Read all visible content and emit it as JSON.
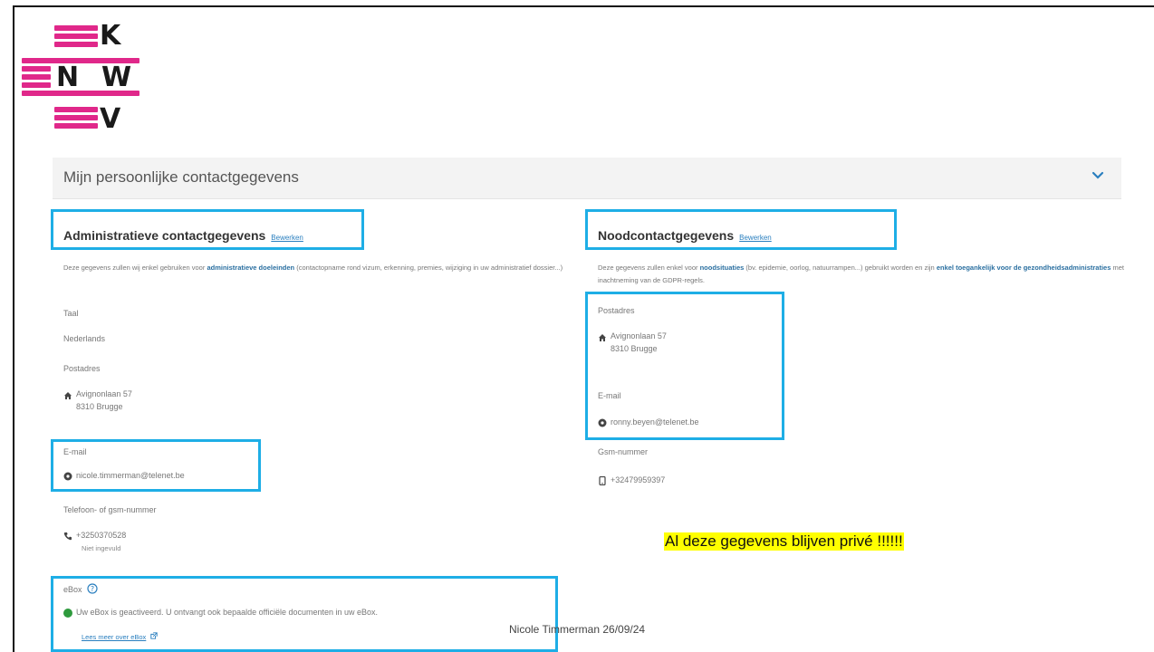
{
  "logo": {
    "letters": [
      "K",
      "N",
      "W",
      "V"
    ],
    "color": "#e0288a",
    "alt": "KNWV"
  },
  "section": {
    "title": "Mijn persoonlijke contactgegevens",
    "chevron_icon": "chevron-down-icon"
  },
  "admin": {
    "title": "Administratieve contactgegevens",
    "edit_label": "Bewerken",
    "desc_before": "Deze gegevens zullen wij enkel gebruiken voor ",
    "desc_bold": "administratieve doeleinden",
    "desc_after": " (contactopname rond vizum, erkenning, premies, wijziging in uw administratief dossier...)",
    "taal_label": "Taal",
    "taal_value": "Nederlands",
    "postadres_label": "Postadres",
    "address_line1": "Avignonlaan 57",
    "address_line2": "8310 Brugge",
    "email_label": "E-mail",
    "email_value": "nicole.timmerman@telenet.be",
    "phone_label": "Telefoon- of gsm-nummer",
    "phone_value": "+3250370528",
    "phone_note": "Niet ingevuld",
    "ebox_label": "eBox",
    "ebox_status": "Uw eBox is geactiveerd. U ontvangt ook bepaalde officiële documenten in uw eBox.",
    "ebox_link": "Lees meer over eBox"
  },
  "emergency": {
    "title": "Noodcontactgegevens",
    "edit_label": "Bewerken",
    "desc_before": "Deze gegevens zullen enkel voor ",
    "desc_bold1": "noodsituaties",
    "desc_mid": " (bv. epidemie, oorlog, natuurrampen...) gebruikt worden en zijn ",
    "desc_bold2": "enkel toegankelijk voor de gezondheidsadministraties",
    "desc_after": " met inachtneming van de GDPR-regels.",
    "postadres_label": "Postadres",
    "address_line1": "Avignonlaan 57",
    "address_line2": "8310 Brugge",
    "email_label": "E-mail",
    "email_value": "ronny.beyen@telenet.be",
    "gsm_label": "Gsm-nummer",
    "gsm_value": "+32479959397"
  },
  "notice": "Al deze gegevens blijven privé !!!!!!",
  "footer": "Nicole Timmerman 26/09/24",
  "colors": {
    "highlight": "#1eaee6",
    "brand": "#e0288a",
    "notice_bg": "#ffff00"
  }
}
